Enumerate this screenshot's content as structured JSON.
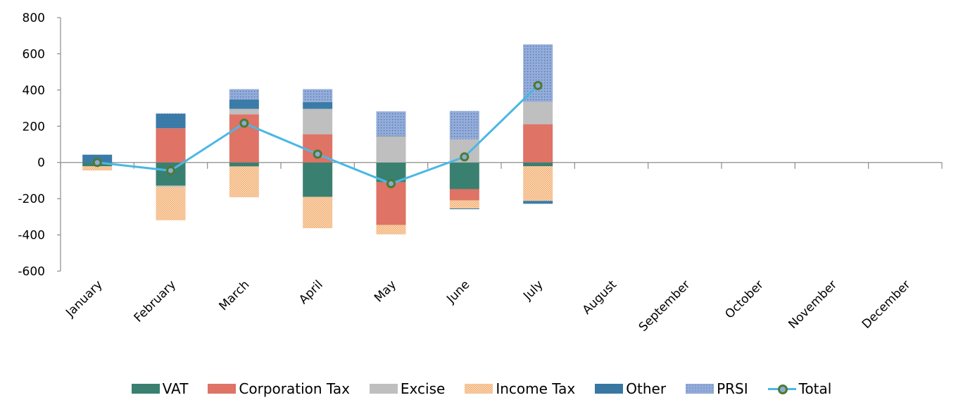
{
  "chart_data": {
    "type": "bar",
    "subtype": "stacked-bar-with-line",
    "title": "",
    "xlabel": "",
    "ylabel": "",
    "ylim": [
      -600,
      800
    ],
    "yticks": [
      800,
      600,
      400,
      200,
      0,
      -200,
      -400,
      -600
    ],
    "categories": [
      "January",
      "February",
      "March",
      "April",
      "May",
      "June",
      "July",
      "August",
      "September",
      "October",
      "November",
      "December"
    ],
    "series": [
      {
        "name": "VAT",
        "type": "bar",
        "color": "#3a8070",
        "pattern": "solid",
        "values": [
          -21,
          -128,
          -22,
          -190,
          -109,
          -147,
          -21,
          null,
          null,
          null,
          null,
          null
        ]
      },
      {
        "name": "Corporation Tax",
        "type": "bar",
        "color": "#de7366",
        "pattern": "solid",
        "values": [
          0,
          189,
          266,
          156,
          -236,
          -62,
          211,
          null,
          null,
          null,
          null,
          null
        ]
      },
      {
        "name": "Excise",
        "type": "bar",
        "color": "#bfbfbf",
        "pattern": "solid",
        "values": [
          0,
          -8,
          30,
          140,
          147,
          128,
          124,
          null,
          null,
          null,
          null,
          null
        ]
      },
      {
        "name": "Income Tax",
        "type": "bar",
        "color": "#f5b27a",
        "pattern": "checker",
        "values": [
          -23,
          -183,
          -170,
          -173,
          -52,
          -45,
          -191,
          null,
          null,
          null,
          null,
          null
        ]
      },
      {
        "name": "Other",
        "type": "bar",
        "color": "#3d7fad",
        "pattern": "fine",
        "values": [
          43,
          80,
          51,
          38,
          1,
          -4,
          -16,
          null,
          null,
          null,
          null,
          null
        ]
      },
      {
        "name": "PRSI",
        "type": "bar",
        "color": "#8fa8d6",
        "pattern": "dots",
        "values": [
          0,
          2,
          58,
          71,
          134,
          156,
          317,
          null,
          null,
          null,
          null,
          null
        ]
      },
      {
        "name": "Total",
        "type": "line",
        "color": "#4ab8e3",
        "marker_fill": "#8fa8d6",
        "marker_edge": "#4a7c2f",
        "values": [
          0,
          -45,
          217,
          46,
          -117,
          31,
          425,
          null,
          null,
          null,
          null,
          null
        ]
      }
    ],
    "legend": {
      "position": "bottom",
      "items": [
        "VAT",
        "Corporation Tax",
        "Excise",
        "Income Tax",
        "Other",
        "PRSI",
        "Total"
      ]
    },
    "grid": false
  }
}
